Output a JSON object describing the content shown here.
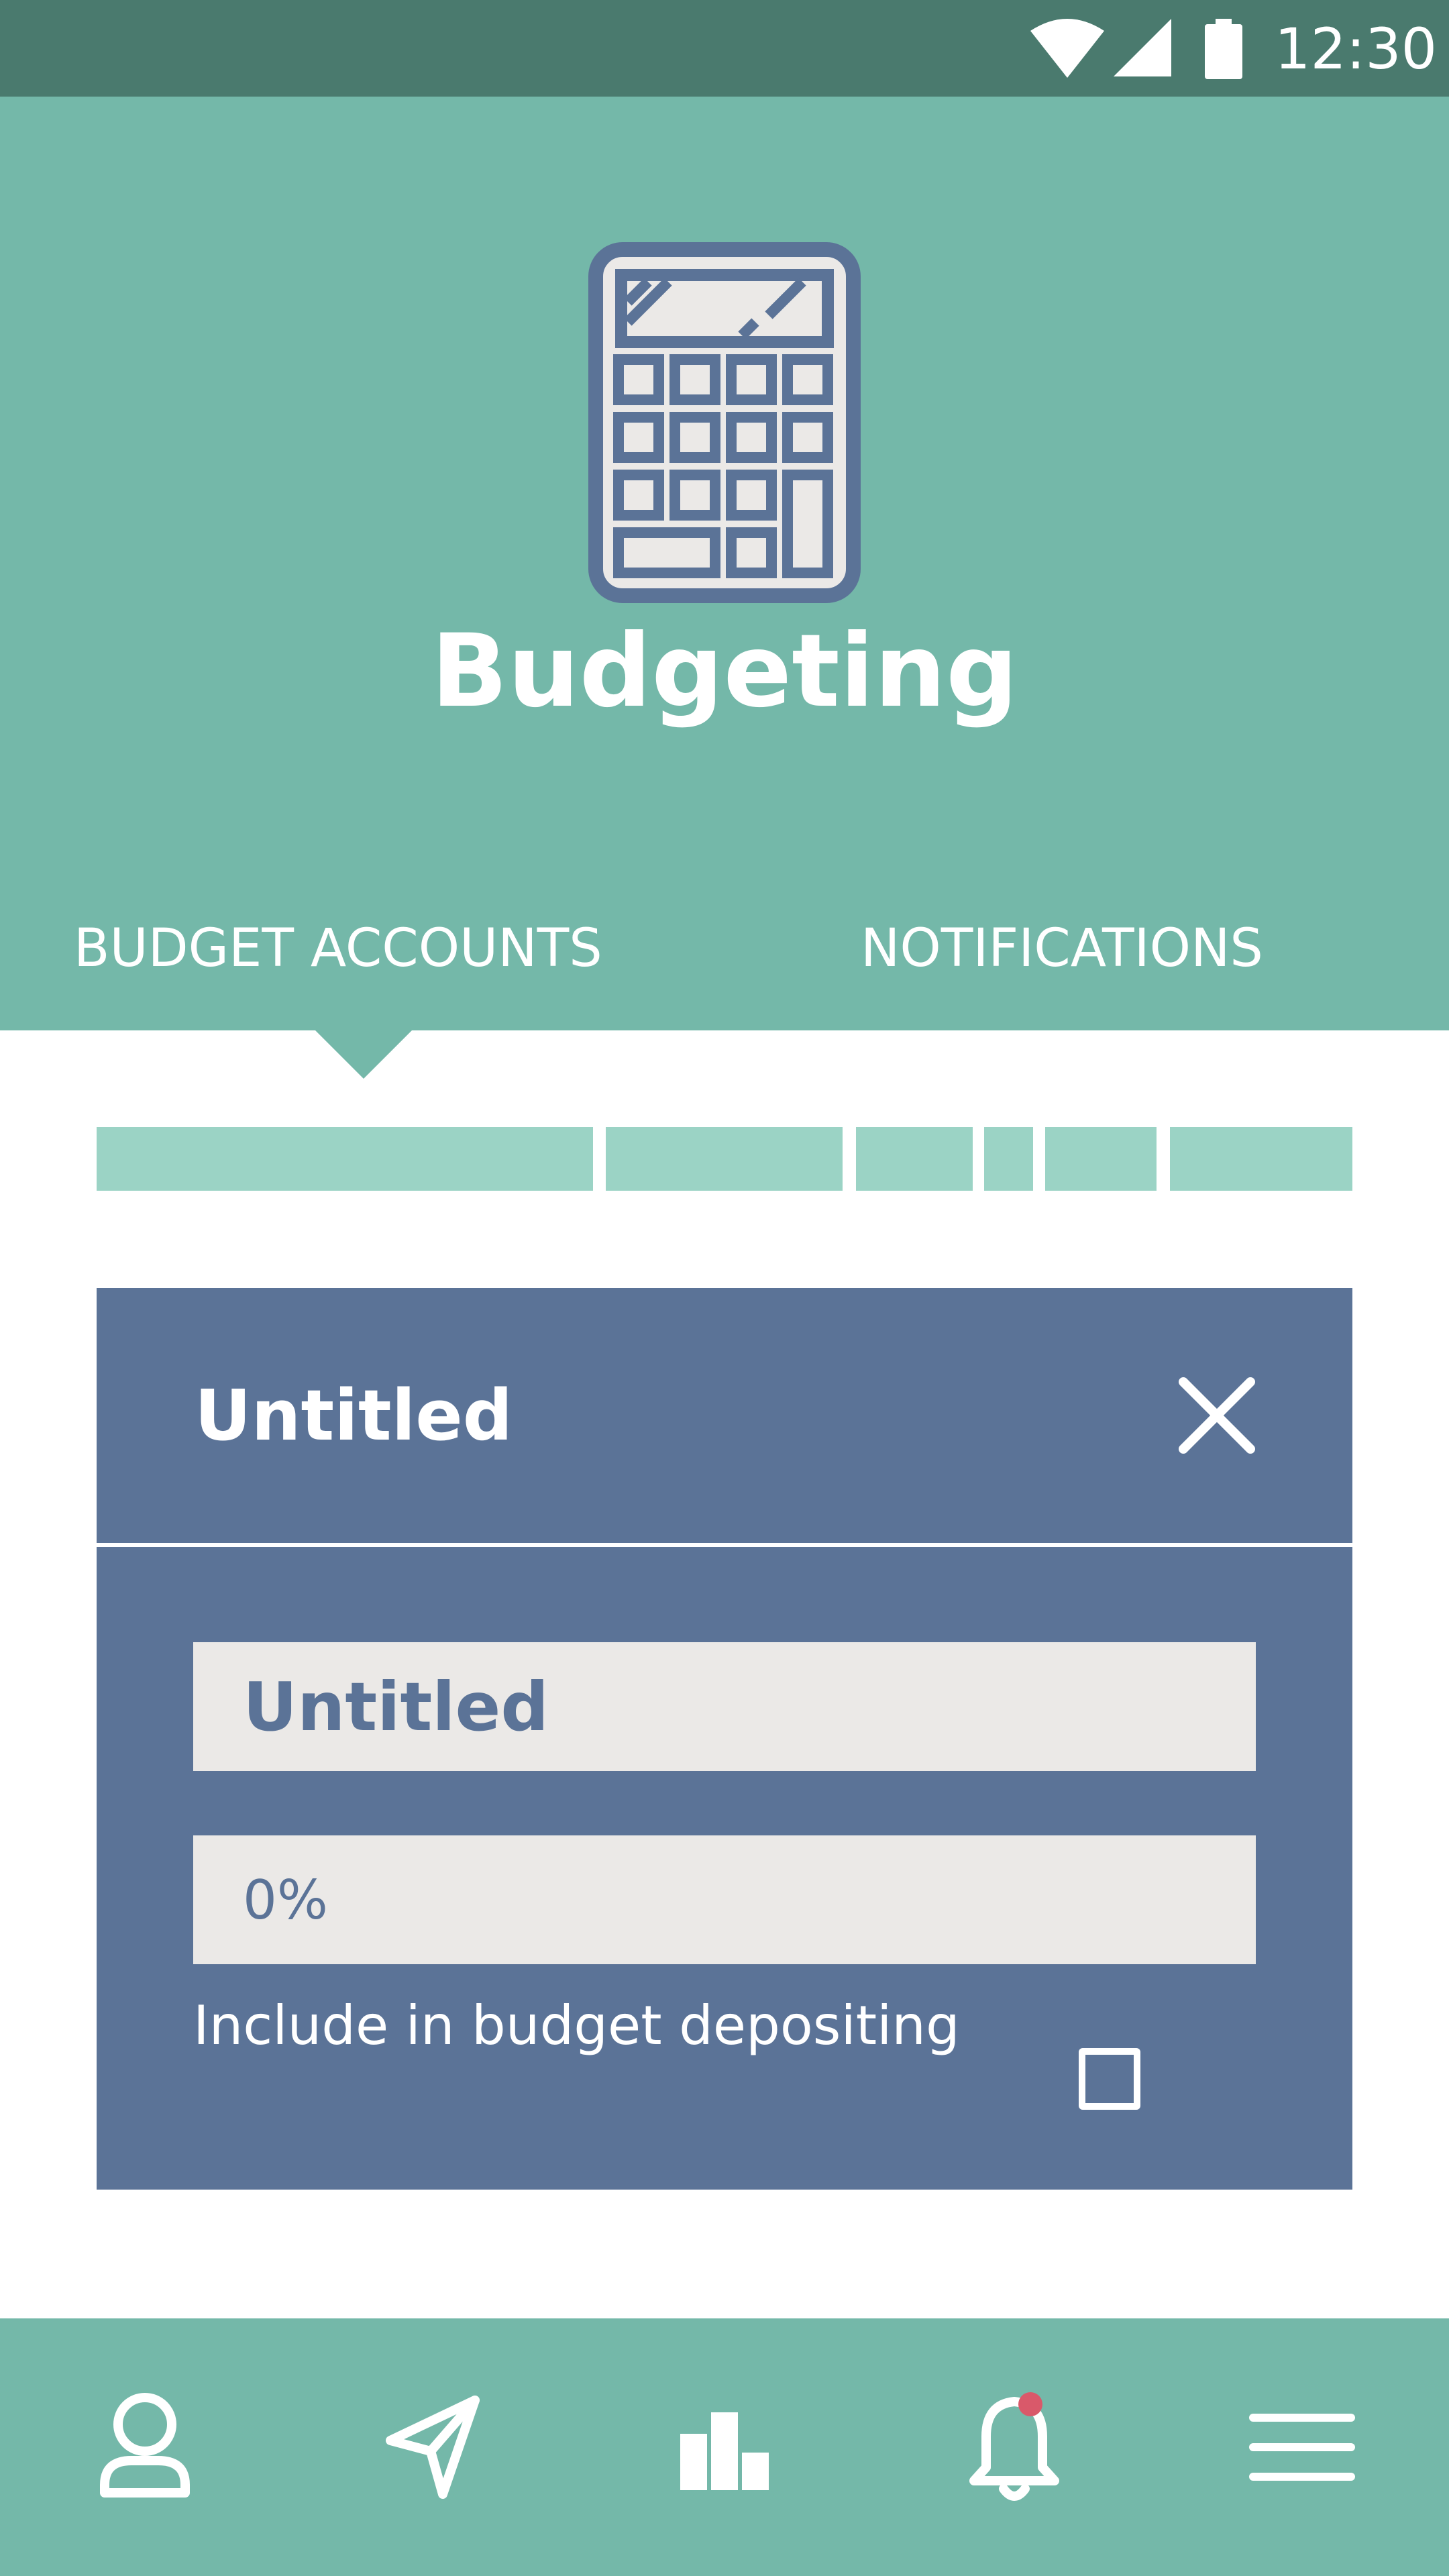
{
  "status_bar": {
    "time": "12:30",
    "icons": [
      "wifi-icon",
      "cell-signal-icon",
      "battery-icon"
    ]
  },
  "header": {
    "icon": "calculator-icon",
    "title": "Budgeting"
  },
  "tabs": [
    {
      "label": "BUDGET ACCOUNTS",
      "selected": true
    },
    {
      "label": "NOTIFICATIONS",
      "selected": false
    }
  ],
  "segments": {
    "count": 6,
    "color": "#9bd3c5"
  },
  "account_card": {
    "title": "Untitled",
    "name_value": "Untitled",
    "percent_value": "0%",
    "include_label": "Include in budget depositing",
    "include_checked": false
  },
  "bottom_nav": {
    "items": [
      {
        "icon": "user-icon"
      },
      {
        "icon": "send-icon"
      },
      {
        "icon": "bar-chart-icon"
      },
      {
        "icon": "bell-icon",
        "has_badge": true
      },
      {
        "icon": "menu-icon"
      }
    ]
  },
  "colors": {
    "status_bar": "#4a7a6e",
    "header": "#74b8a9",
    "card": "#5b7397",
    "field": "#ebe9e7",
    "badge": "#d9596a"
  }
}
